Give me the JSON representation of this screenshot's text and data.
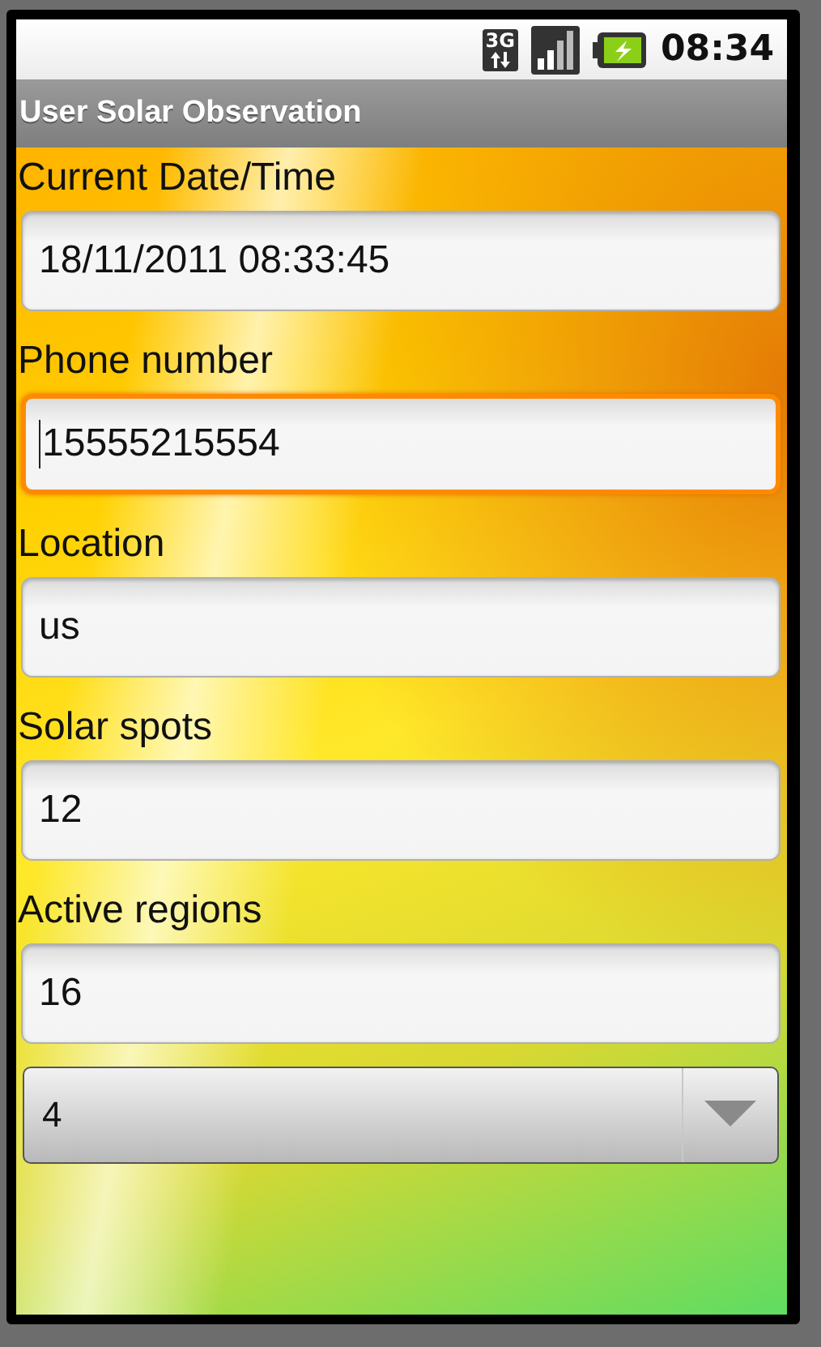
{
  "status_bar": {
    "network": "3G",
    "time": "08:34"
  },
  "title_bar": {
    "title": "User Solar Observation"
  },
  "fields": [
    {
      "label": "Current Date/Time",
      "value": "18/11/2011 08:33:45",
      "focused": false
    },
    {
      "label": "Phone number",
      "value": "15555215554",
      "focused": true
    },
    {
      "label": "Location",
      "value": "us",
      "focused": false
    },
    {
      "label": "Solar spots",
      "value": "12",
      "focused": false
    },
    {
      "label": "Active regions",
      "value": "16",
      "focused": false
    }
  ],
  "spinner": {
    "value": "4"
  }
}
